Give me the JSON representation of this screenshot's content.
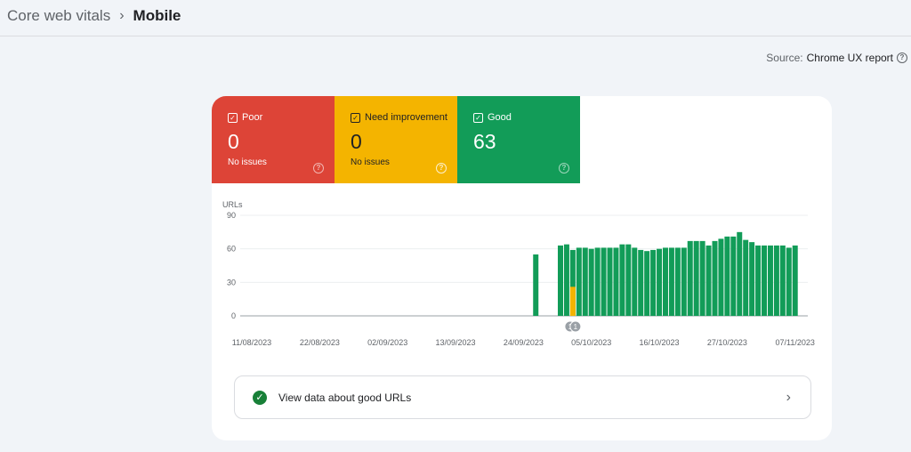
{
  "breadcrumb": {
    "parent": "Core web vitals",
    "separator": "›",
    "current": "Mobile"
  },
  "source": {
    "label": "Source:",
    "value": "Chrome UX report",
    "icon": "help-icon"
  },
  "tiles": [
    {
      "label": "Poor",
      "count": "0",
      "sub": "No issues",
      "color": "#dd4437"
    },
    {
      "label": "Need improvement",
      "count": "0",
      "sub": "No issues",
      "color": "#f4b400"
    },
    {
      "label": "Good",
      "count": "63",
      "sub": "",
      "color": "#129c58"
    }
  ],
  "chart_data": {
    "type": "bar",
    "ylabel": "URLs",
    "ylim": [
      0,
      90
    ],
    "yticks": [
      "0",
      "30",
      "60",
      "90"
    ],
    "xticks": [
      "11/08/2023",
      "22/08/2023",
      "02/09/2023",
      "13/09/2023",
      "24/09/2023",
      "05/10/2023",
      "16/10/2023",
      "27/10/2023",
      "07/11/2023"
    ],
    "grid": true,
    "annotation": {
      "date": "02/10/2023",
      "label": "1"
    },
    "series": [
      {
        "name": "Good",
        "color": "#129c58",
        "start_date": "2023-09-30",
        "values": [
          63,
          64,
          59,
          61,
          61,
          60,
          61,
          61,
          61,
          61,
          64,
          64,
          61,
          59,
          58,
          59,
          60,
          61,
          61,
          61,
          61,
          67,
          67,
          67,
          63,
          67,
          69,
          71,
          71,
          75,
          68,
          66,
          63,
          63,
          63,
          63,
          63,
          61,
          63
        ],
        "extra": {
          "date": "2023-09-26",
          "value": 55
        }
      },
      {
        "name": "Need improvement",
        "color": "#f4b400",
        "points": [
          {
            "date": "2023-10-02",
            "value": 26
          }
        ]
      }
    ]
  },
  "link": {
    "label": "View data about good URLs",
    "arrow": "›"
  }
}
